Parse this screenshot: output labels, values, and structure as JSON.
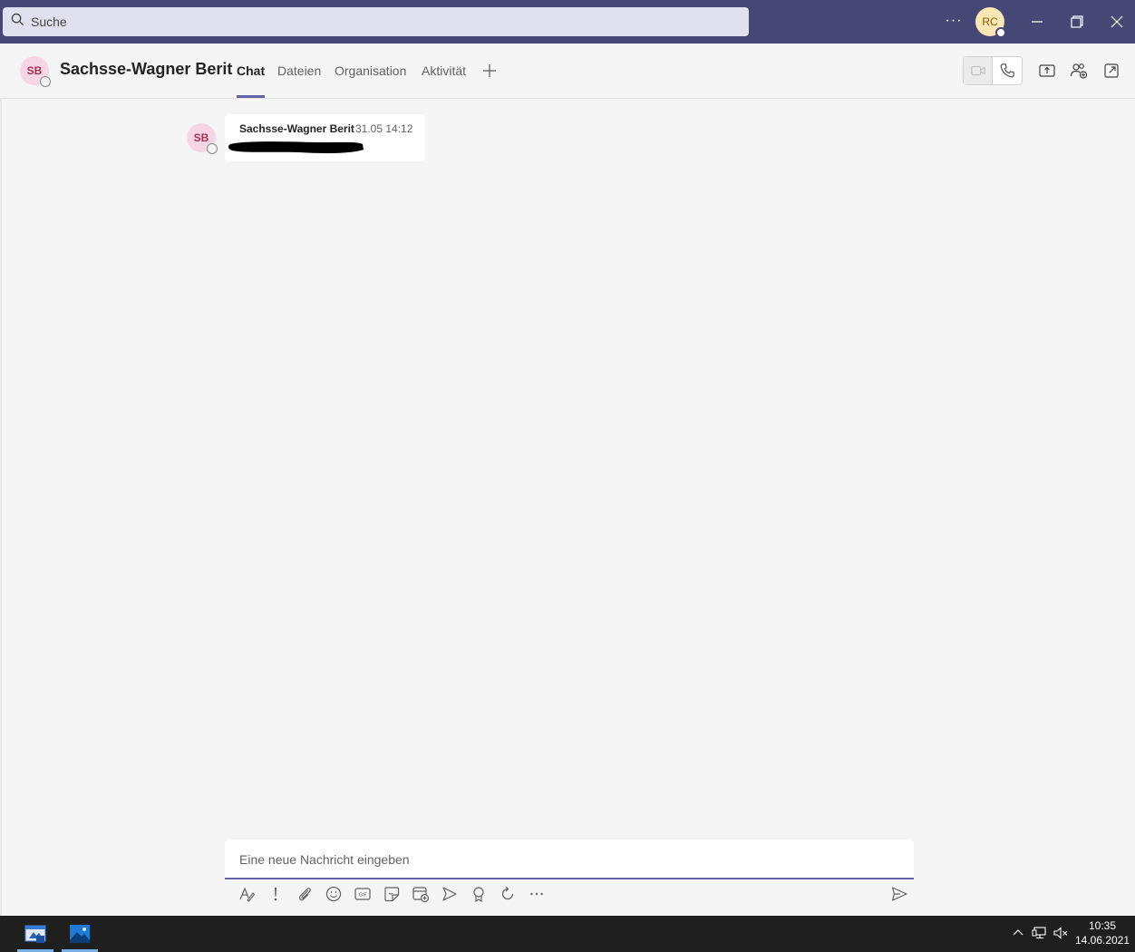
{
  "titlebar": {
    "search_placeholder": "Suche",
    "more_label": "···",
    "user_initials": "RC"
  },
  "chat_header": {
    "avatar_initials": "SB",
    "contact_name": "Sachsse-Wagner Berit",
    "tabs": [
      {
        "label": "Chat",
        "active": true
      },
      {
        "label": "Dateien",
        "active": false
      },
      {
        "label": "Organisation",
        "active": false
      },
      {
        "label": "Aktivität",
        "active": false
      }
    ]
  },
  "messages": [
    {
      "avatar_initials": "SB",
      "author": "Sachsse-Wagner Berit",
      "timestamp": "31.05 14:12",
      "body_redacted": true
    }
  ],
  "compose": {
    "placeholder": "Eine neue Nachricht eingeben",
    "toolbar_icons": [
      "format-icon",
      "important-icon",
      "attach-icon",
      "emoji-icon",
      "gif-icon",
      "sticker-icon",
      "schedule-meeting-icon",
      "stream-icon",
      "praise-icon",
      "loop-icon",
      "more-options-icon",
      "send-icon"
    ]
  },
  "taskbar": {
    "time": "10:35",
    "date": "14.06.2021"
  },
  "colors": {
    "titlebar": "#464775",
    "accent": "#6264a7",
    "background": "#f5f5f5",
    "taskbar": "#1f1f1f"
  }
}
